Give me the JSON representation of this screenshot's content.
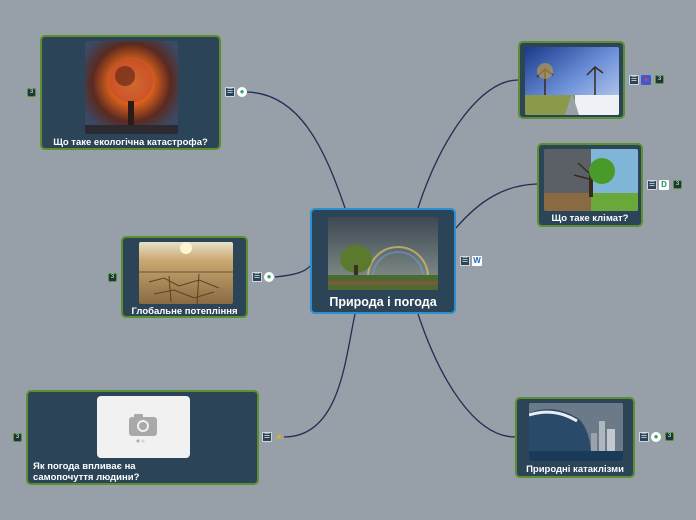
{
  "central": {
    "title": "Природа і погода"
  },
  "topics": {
    "catastrophe": {
      "title": "Що таке екологічна катастрофа?",
      "count": "3"
    },
    "warming": {
      "title": "Глобальне потепління",
      "count": "3"
    },
    "wellbeing": {
      "title": "Як погода впливає на самопочуття людини?",
      "count": "3"
    },
    "seasons": {
      "title": "",
      "count": "3"
    },
    "climate": {
      "title": "Що таке клімат?",
      "count": "3"
    },
    "cataclysms": {
      "title": "Природні катаклізми",
      "count": "3"
    }
  },
  "colors": {
    "background": "#97a0a8",
    "node": "#2b4457",
    "topic_border": "#5c8f2e",
    "central_border": "#2b8fd1",
    "connector": "#1f2f55"
  },
  "icons": [
    "note-icon",
    "globe-icon",
    "wikipedia-icon",
    "dictionary-icon",
    "flag-icon",
    "weather-icon",
    "camera-icon"
  ]
}
